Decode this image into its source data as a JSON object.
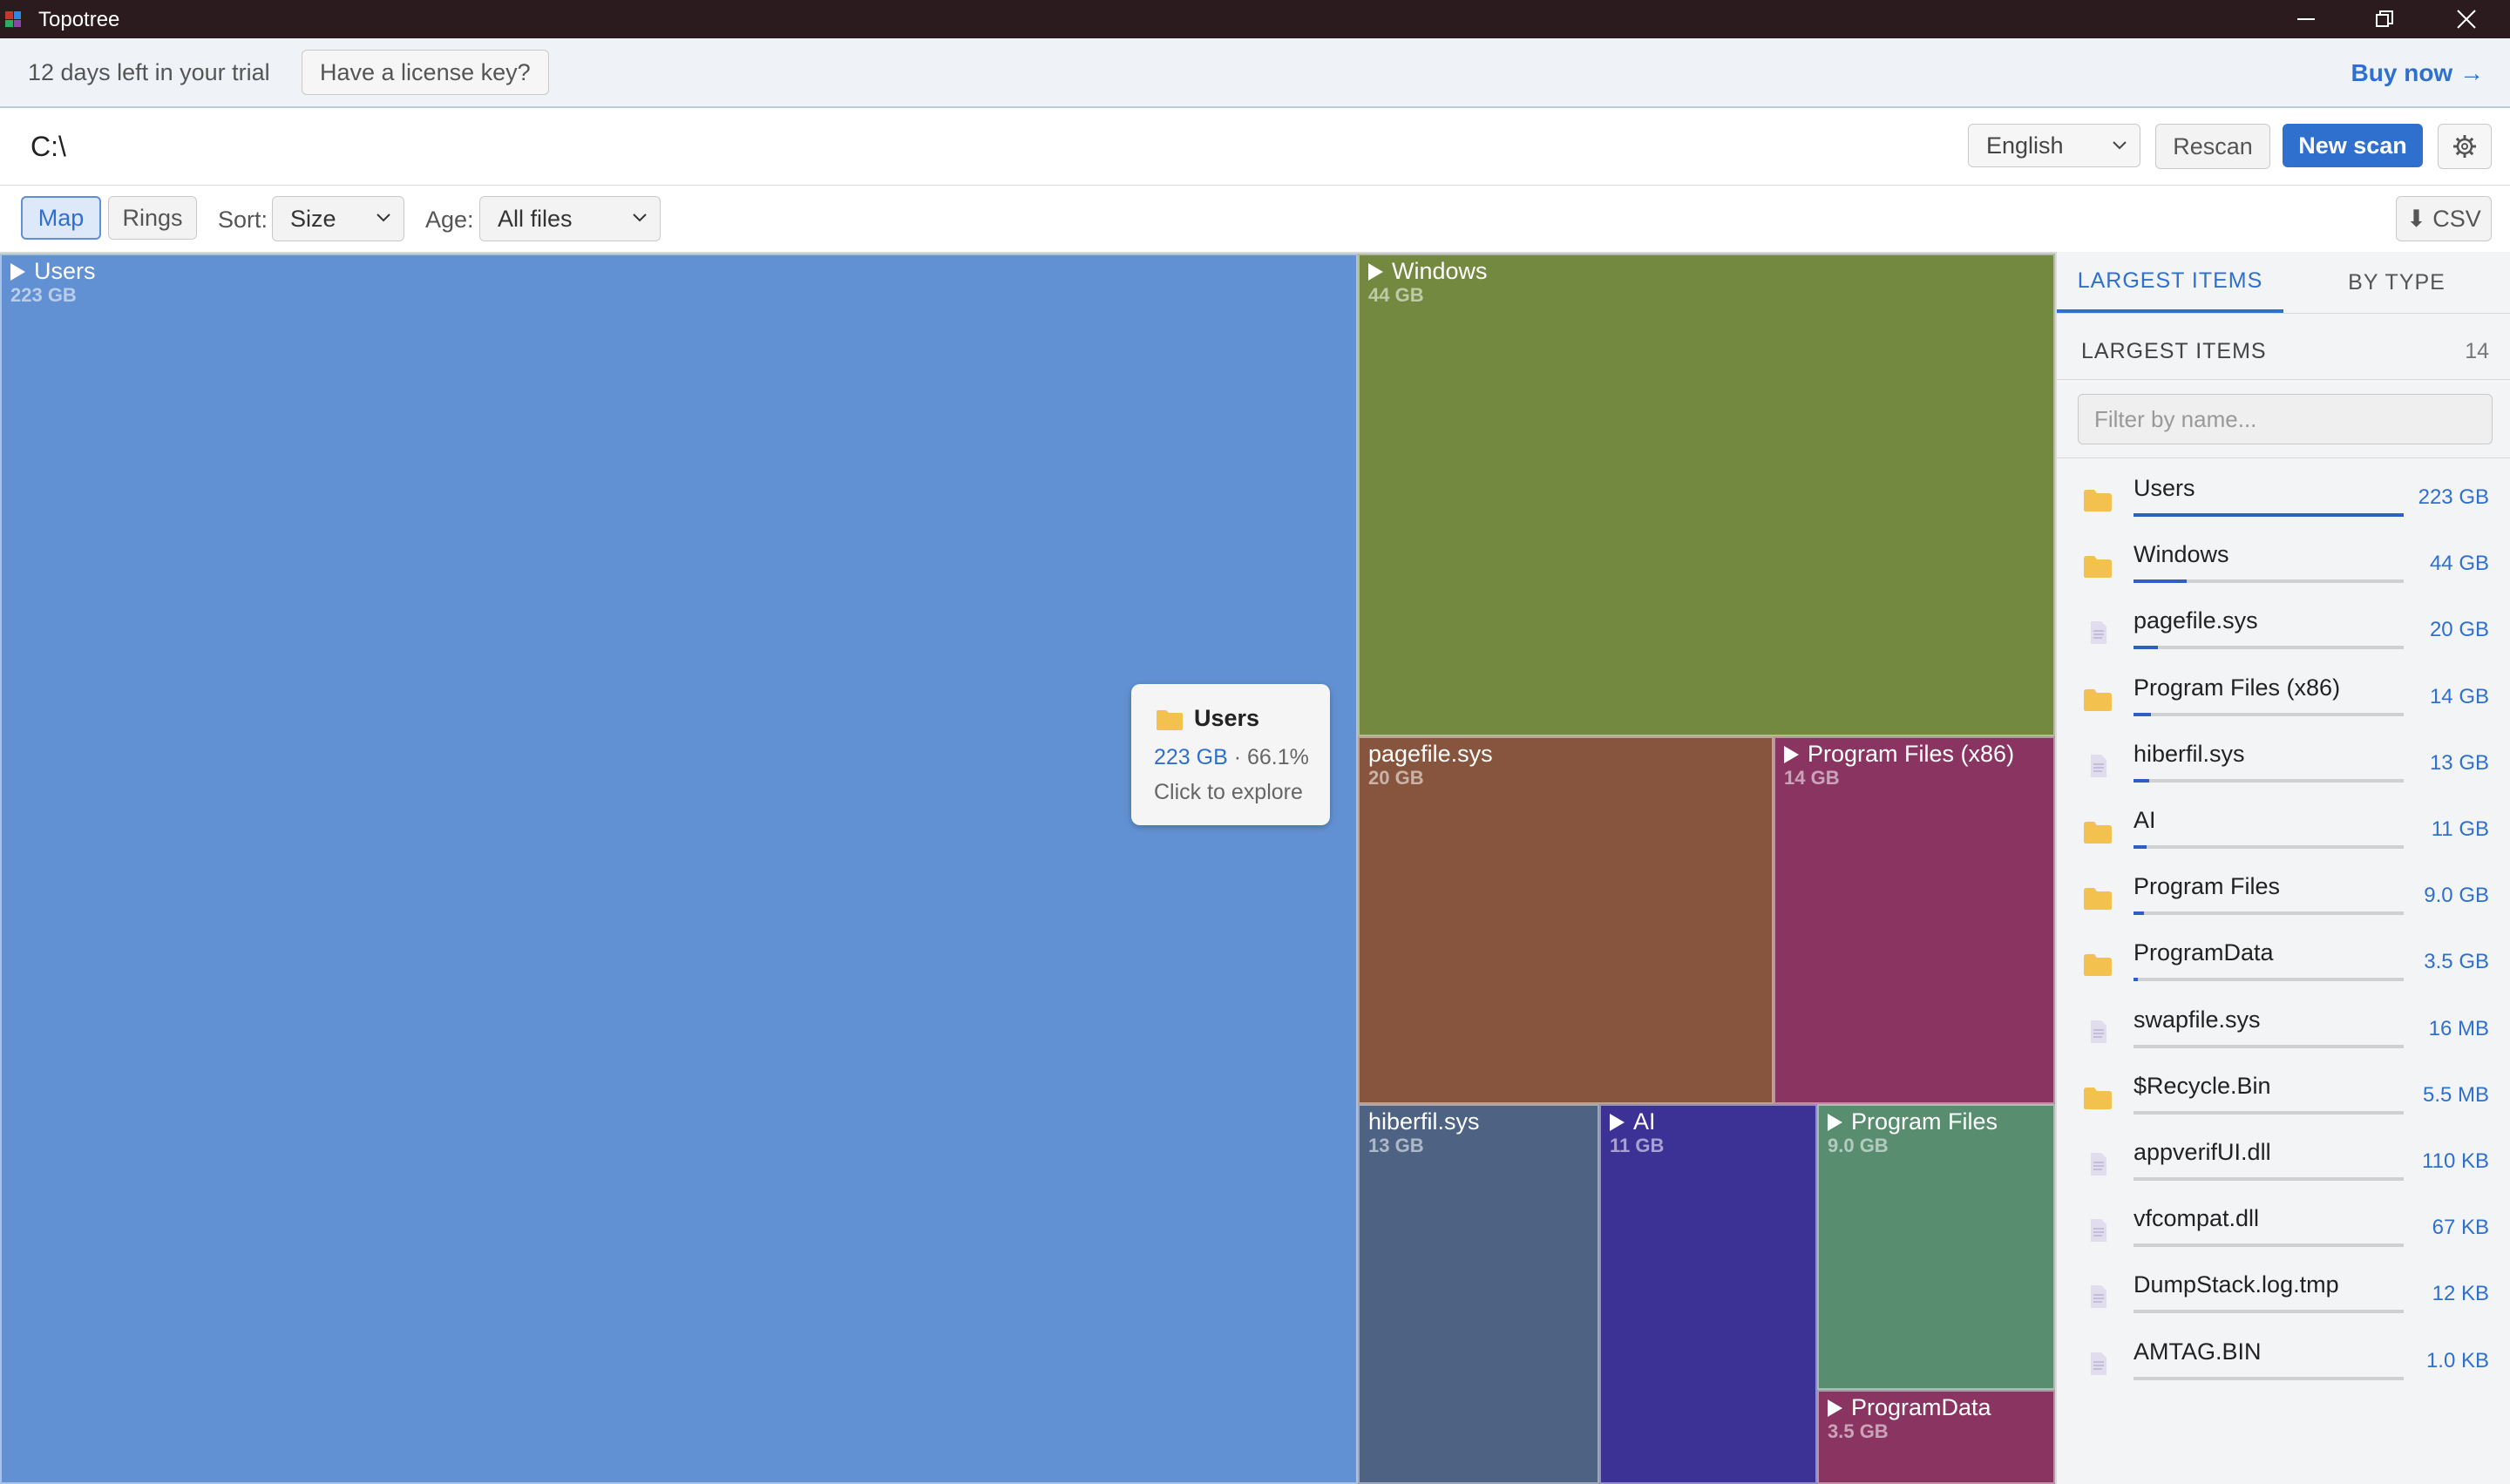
{
  "window": {
    "title": "Topotree",
    "controls": [
      "minimize",
      "restore",
      "close"
    ]
  },
  "trial": {
    "message": "12 days left in your trial",
    "license_label": "Have a license key?",
    "buy_label": "Buy now →"
  },
  "pathbar": {
    "path": "C:\\",
    "language": "English",
    "rescan_label": "Rescan",
    "newscan_label": "New scan"
  },
  "toolbar": {
    "map_label": "Map",
    "rings_label": "Rings",
    "sort_label": "Sort:",
    "sort_value": "Size",
    "age_label": "Age:",
    "age_value": "All files",
    "csv_label": "⬇ CSV",
    "active_view": "Map"
  },
  "treemap": {
    "tiles": [
      {
        "name": "Users",
        "size": "223 GB",
        "expandable": true,
        "color": "#6291d3"
      },
      {
        "name": "Windows",
        "size": "44 GB",
        "expandable": true,
        "color": "#72893f"
      },
      {
        "name": "pagefile.sys",
        "size": "20 GB",
        "expandable": false,
        "color": "#87553e"
      },
      {
        "name": "Program Files (x86)",
        "size": "14 GB",
        "expandable": true,
        "color": "#8a3462"
      },
      {
        "name": "hiberfil.sys",
        "size": "13 GB",
        "expandable": false,
        "color": "#4e6383"
      },
      {
        "name": "AI",
        "size": "11 GB",
        "expandable": true,
        "color": "#3c3195"
      },
      {
        "name": "Program Files",
        "size": "9.0 GB",
        "expandable": true,
        "color": "#588d6f"
      },
      {
        "name": "ProgramData",
        "size": "3.5 GB",
        "expandable": true,
        "color": "#8a3462"
      }
    ]
  },
  "tooltip": {
    "name": "Users",
    "size": "223 GB",
    "separator": " · ",
    "percent": "66.1%",
    "hint": "Click to explore",
    "icon": "folder-icon"
  },
  "side": {
    "tab_largest": "LARGEST ITEMS",
    "tab_type": "BY TYPE",
    "header": "LARGEST ITEMS",
    "count": "14",
    "filter_placeholder": "Filter by name...",
    "items": [
      {
        "name": "Users",
        "size": "223 GB",
        "kind": "folder",
        "share": 1.0
      },
      {
        "name": "Windows",
        "size": "44 GB",
        "kind": "folder",
        "share": 0.197
      },
      {
        "name": "pagefile.sys",
        "size": "20 GB",
        "kind": "file",
        "share": 0.09
      },
      {
        "name": "Program Files (x86)",
        "size": "14 GB",
        "kind": "folder",
        "share": 0.063
      },
      {
        "name": "hiberfil.sys",
        "size": "13 GB",
        "kind": "file",
        "share": 0.058
      },
      {
        "name": "AI",
        "size": "11 GB",
        "kind": "folder",
        "share": 0.049
      },
      {
        "name": "Program Files",
        "size": "9.0 GB",
        "kind": "folder",
        "share": 0.04
      },
      {
        "name": "ProgramData",
        "size": "3.5 GB",
        "kind": "folder",
        "share": 0.016
      },
      {
        "name": "swapfile.sys",
        "size": "16 MB",
        "kind": "file",
        "share": 0.0
      },
      {
        "name": "$Recycle.Bin",
        "size": "5.5 MB",
        "kind": "folder",
        "share": 0.0
      },
      {
        "name": "appverifUI.dll",
        "size": "110 KB",
        "kind": "file",
        "share": 0.0
      },
      {
        "name": "vfcompat.dll",
        "size": "67 KB",
        "kind": "file",
        "share": 0.0
      },
      {
        "name": "DumpStack.log.tmp",
        "size": "12 KB",
        "kind": "file",
        "share": 0.0
      },
      {
        "name": "AMTAG.BIN",
        "size": "1.0 KB",
        "kind": "file",
        "share": 0.0
      }
    ]
  },
  "colors": {
    "accent": "#2f6fce",
    "titlebar": "#2b1b1e",
    "folder": "#f2c14e",
    "file": "#d9d4e8"
  }
}
